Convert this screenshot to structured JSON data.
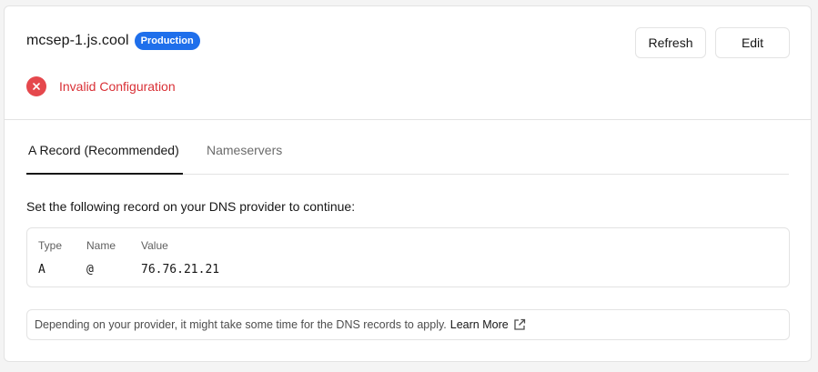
{
  "domain": {
    "name": "mcsep-1.js.cool",
    "environment_badge": "Production"
  },
  "actions": {
    "refresh_label": "Refresh",
    "edit_label": "Edit"
  },
  "status": {
    "icon": "x-circle-icon",
    "text": "Invalid Configuration"
  },
  "tabs": [
    {
      "label": "A Record (Recommended)",
      "active": true
    },
    {
      "label": "Nameservers",
      "active": false
    }
  ],
  "instruction": "Set the following record on your DNS provider to continue:",
  "record_table": {
    "headers": [
      "Type",
      "Name",
      "Value"
    ],
    "rows": [
      [
        "A",
        "@",
        "76.76.21.21"
      ]
    ]
  },
  "note": {
    "text": "Depending on your provider, it might take some time for the DNS records to apply.",
    "link_label": "Learn More",
    "link_icon": "external-link-icon"
  },
  "colors": {
    "badge": "#1f6feb",
    "error": "#e5484d",
    "border": "#e3e3e3"
  }
}
